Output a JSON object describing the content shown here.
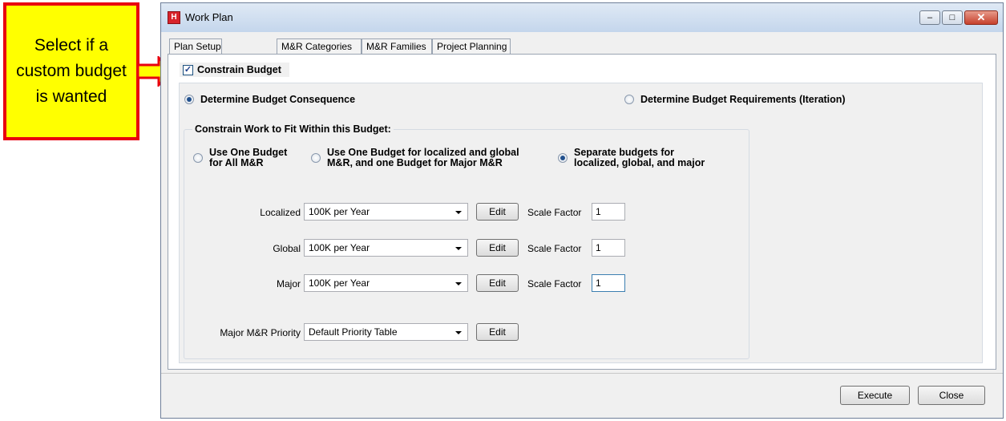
{
  "callout": {
    "text": "Select if a custom budget is wanted"
  },
  "window": {
    "title": "Work Plan",
    "app_icon_glyph": "H",
    "controls": {
      "minimize": "–",
      "maximize": "□",
      "close": "✕"
    }
  },
  "tabs": [
    "Plan Setup",
    "M&R Categories",
    "M&R Families",
    "Project Planning"
  ],
  "constrain_budget": {
    "label": "Constrain Budget",
    "checked": true,
    "check_glyph": "✓"
  },
  "mode_options": [
    {
      "label": "Determine Budget Consequence",
      "selected": true
    },
    {
      "label": "Determine Budget Requirements (Iteration)",
      "selected": false
    }
  ],
  "group": {
    "title": "Constrain Work to Fit Within this Budget:",
    "budget_options": [
      {
        "line1": "Use One Budget",
        "line2": "for All M&R",
        "selected": false
      },
      {
        "line1": "Use One Budget for localized and global",
        "line2": "M&R, and one Budget for Major M&R",
        "selected": false
      },
      {
        "line1": "Separate budgets for",
        "line2": "localized, global, and major",
        "selected": true
      }
    ],
    "rows": [
      {
        "label": "Localized",
        "value": "100K per Year",
        "edit": "Edit",
        "scale_label": "Scale Factor",
        "scale_value": "1"
      },
      {
        "label": "Global",
        "value": "100K per Year",
        "edit": "Edit",
        "scale_label": "Scale Factor",
        "scale_value": "1"
      },
      {
        "label": "Major",
        "value": "100K per Year",
        "edit": "Edit",
        "scale_label": "Scale Factor",
        "scale_value": "1"
      }
    ],
    "priority": {
      "label": "Major M&R Priority",
      "value": "Default Priority Table",
      "edit": "Edit"
    }
  },
  "footer": {
    "execute": "Execute",
    "close": "Close"
  },
  "colors": {
    "callout_fill": "#ffff00",
    "callout_border": "#e8000f",
    "selected_radio": "#21508d"
  }
}
